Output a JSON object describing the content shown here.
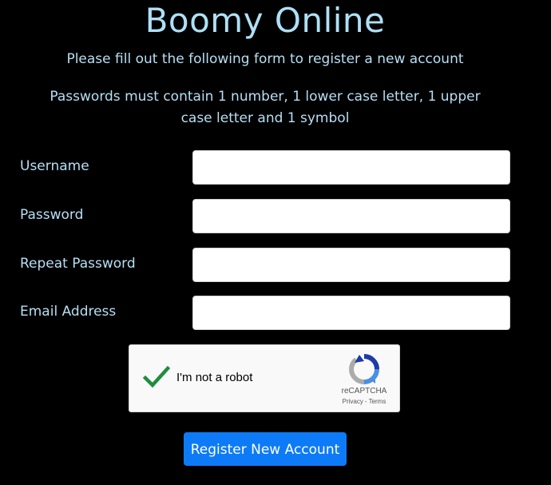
{
  "page": {
    "title": "Boomy Online",
    "subtitle": "Please fill out the following form to register a new account",
    "password_rules": "Passwords must contain 1 number, 1 lower case letter, 1 upper case letter and 1 symbol"
  },
  "form": {
    "username_label": "Username",
    "username_value": "",
    "password_label": "Password",
    "password_value": "",
    "repeat_password_label": "Repeat Password",
    "repeat_password_value": "",
    "email_label": "Email Address",
    "email_value": ""
  },
  "captcha": {
    "checked": true,
    "label": "I'm not a robot",
    "brand": "reCAPTCHA",
    "privacy_link": "Privacy",
    "separator": "-",
    "terms_link": "Terms",
    "check_color": "#1e8e3e",
    "icon": "recaptcha-logo-icon"
  },
  "actions": {
    "register_label": "Register New Account"
  },
  "colors": {
    "background": "#000000",
    "text": "#b7dff4",
    "primary_button": "#0d7bf7"
  }
}
